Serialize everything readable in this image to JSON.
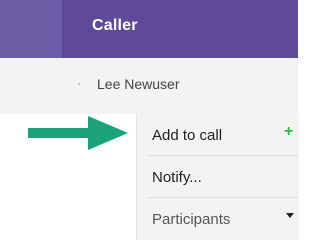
{
  "header": {
    "title": "Caller"
  },
  "caller": {
    "name": "Lee Newuser"
  },
  "menu": {
    "items": [
      {
        "label": "Add to call",
        "icon": "plus-icon"
      },
      {
        "label": "Notify..."
      },
      {
        "label": "Participants",
        "icon": "caret-down-icon"
      }
    ]
  },
  "colors": {
    "header": "#5e4a96",
    "arrow": "#1aa37a",
    "plus": "#2eb34b"
  }
}
